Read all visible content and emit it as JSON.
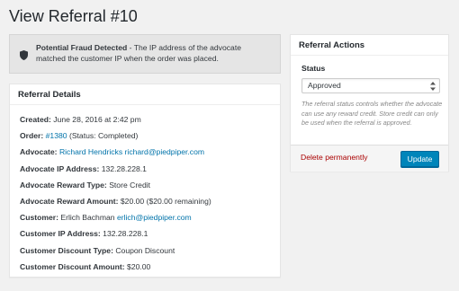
{
  "page": {
    "title": "View Referral #10"
  },
  "notice": {
    "icon": "shield-icon",
    "title": "Potential Fraud Detected",
    "message": " - The IP address of the advocate matched the customer IP when the order was placed."
  },
  "details": {
    "title": "Referral Details",
    "created": {
      "label": "Created:",
      "value": "June 28, 2016 at 2:42 pm"
    },
    "order": {
      "label": "Order:",
      "link": "#1380",
      "suffix": "(Status: Completed)"
    },
    "advocate": {
      "label": "Advocate:",
      "name": "Richard Hendricks",
      "email": "richard@piedpiper.com"
    },
    "advocate_ip": {
      "label": "Advocate IP Address:",
      "value": "132.28.228.1"
    },
    "advocate_reward_type": {
      "label": "Advocate Reward Type:",
      "value": "Store Credit"
    },
    "advocate_reward_amount": {
      "label": "Advocate Reward Amount:",
      "value": "$20.00 ($20.00 remaining)"
    },
    "customer": {
      "label": "Customer:",
      "name": "Erlich Bachman",
      "email": "erlich@piedpiper.com"
    },
    "customer_ip": {
      "label": "Customer IP Address:",
      "value": "132.28.228.1"
    },
    "customer_discount_type": {
      "label": "Customer Discount Type:",
      "value": "Coupon Discount"
    },
    "customer_discount_amount": {
      "label": "Customer Discount Amount:",
      "value": "$20.00"
    }
  },
  "actions": {
    "title": "Referral Actions",
    "status_label": "Status",
    "status_value": "Approved",
    "help": "The referral status controls whether the advocate can use any reward credit. Store credit can only be used when the referral is approved.",
    "delete_label": "Delete permanently",
    "update_label": "Update"
  },
  "colors": {
    "link": "#0073aa",
    "delete": "#a00000",
    "primary": "#0085ba"
  }
}
